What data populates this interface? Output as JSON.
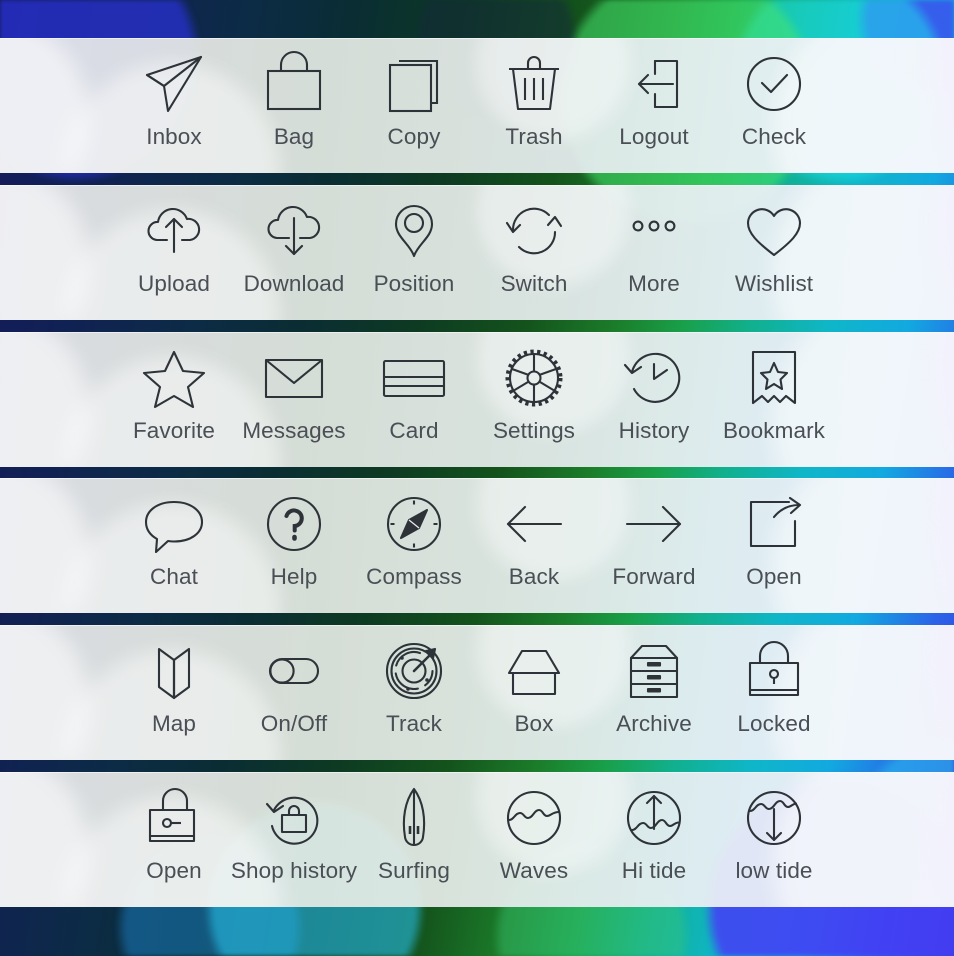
{
  "meta": {
    "title": "Thin line icon set sheet",
    "columns": 6,
    "rows": 6,
    "label_color": "#4a4f55",
    "icon_stroke_color": "#2d3338",
    "panel_color": "#e8eaee",
    "background_colors": [
      "#151a5e",
      "#14531c",
      "#11b08e",
      "#12a9e0",
      "#3a3fe0"
    ]
  },
  "rows": [
    {
      "index": 1,
      "items": [
        {
          "label": "Inbox",
          "icon": "send-paper-plane-icon"
        },
        {
          "label": "Bag",
          "icon": "shopping-bag-icon"
        },
        {
          "label": "Copy",
          "icon": "copy-pages-icon"
        },
        {
          "label": "Trash",
          "icon": "trash-can-icon"
        },
        {
          "label": "Logout",
          "icon": "logout-arrow-icon"
        },
        {
          "label": "Check",
          "icon": "check-circle-icon"
        }
      ]
    },
    {
      "index": 2,
      "items": [
        {
          "label": "Upload",
          "icon": "cloud-upload-icon"
        },
        {
          "label": "Download",
          "icon": "cloud-download-icon"
        },
        {
          "label": "Position",
          "icon": "map-pin-icon"
        },
        {
          "label": "Switch",
          "icon": "refresh-switch-icon"
        },
        {
          "label": "More",
          "icon": "three-dots-icon"
        },
        {
          "label": "Wishlist",
          "icon": "heart-icon"
        }
      ]
    },
    {
      "index": 3,
      "items": [
        {
          "label": "Favorite",
          "icon": "star-icon"
        },
        {
          "label": "Messages",
          "icon": "envelope-icon"
        },
        {
          "label": "Card",
          "icon": "credit-card-icon"
        },
        {
          "label": "Settings",
          "icon": "gear-wheel-icon"
        },
        {
          "label": "History",
          "icon": "clock-rewind-icon"
        },
        {
          "label": "Bookmark",
          "icon": "bookmark-star-icon"
        }
      ]
    },
    {
      "index": 4,
      "items": [
        {
          "label": "Chat",
          "icon": "speech-bubble-icon"
        },
        {
          "label": "Help",
          "icon": "question-circle-icon"
        },
        {
          "label": "Compass",
          "icon": "compass-icon"
        },
        {
          "label": "Back",
          "icon": "arrow-left-icon"
        },
        {
          "label": "Forward",
          "icon": "arrow-right-icon"
        },
        {
          "label": "Open",
          "icon": "open-external-icon"
        }
      ]
    },
    {
      "index": 5,
      "items": [
        {
          "label": "Map",
          "icon": "folded-map-icon"
        },
        {
          "label": "On/Off",
          "icon": "toggle-switch-icon"
        },
        {
          "label": "Track",
          "icon": "radar-track-icon"
        },
        {
          "label": "Box",
          "icon": "open-box-icon"
        },
        {
          "label": "Archive",
          "icon": "archive-drawers-icon"
        },
        {
          "label": "Locked",
          "icon": "padlock-closed-icon"
        }
      ]
    },
    {
      "index": 6,
      "items": [
        {
          "label": "Open",
          "icon": "padlock-open-icon"
        },
        {
          "label": "Shop history",
          "icon": "shop-history-icon"
        },
        {
          "label": "Surfing",
          "icon": "surfboard-icon"
        },
        {
          "label": "Waves",
          "icon": "waves-circle-icon"
        },
        {
          "label": "Hi tide",
          "icon": "high-tide-icon"
        },
        {
          "label": "low tide",
          "icon": "low-tide-icon"
        }
      ]
    }
  ]
}
